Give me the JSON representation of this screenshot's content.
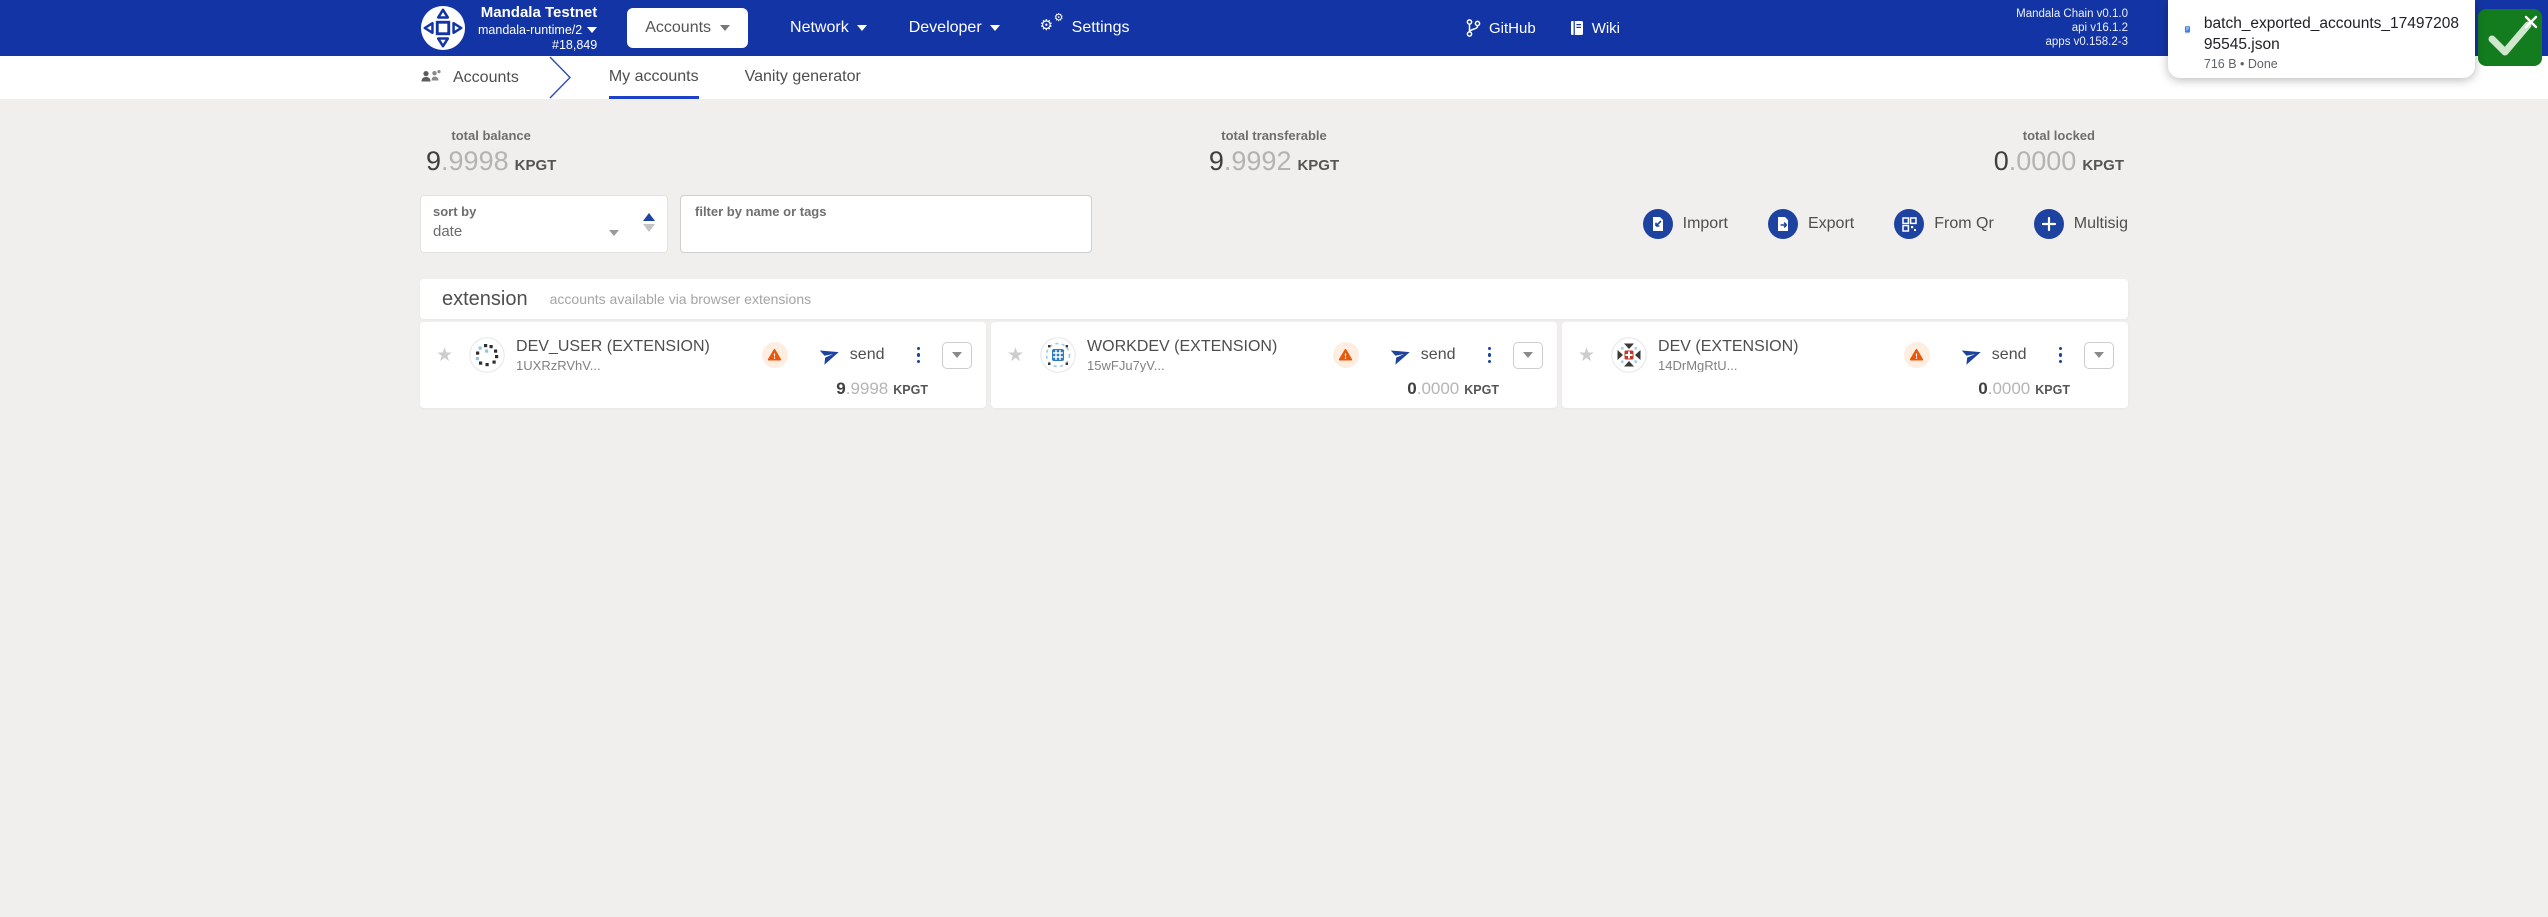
{
  "header": {
    "chain": {
      "name": "Mandala Testnet",
      "runtime": "mandala-runtime/2",
      "block": "#18,849"
    },
    "menu_accounts": "Accounts",
    "menu_network": "Network",
    "menu_developer": "Developer",
    "menu_settings": "Settings",
    "link_github": "GitHub",
    "link_wiki": "Wiki",
    "version": {
      "line1": "Mandala Chain v0.1.0",
      "line2": "api v16.1.2",
      "line3": "apps v0.158.2-3"
    }
  },
  "download_toast": {
    "filename_line1": "batch_exported_accounts_17497208",
    "filename_line2": "95545.json",
    "meta": "716 B • Done"
  },
  "subnav": {
    "breadcrumb": "Accounts",
    "tab_my_accounts": "My accounts",
    "tab_vanity": "Vanity generator"
  },
  "summary": {
    "columns": [
      {
        "label": "total balance",
        "int": "9",
        "frac": ".9998",
        "unit": "KPGT"
      },
      {
        "label": "total transferable",
        "int": "9",
        "frac": ".9992",
        "unit": "KPGT"
      },
      {
        "label": "total locked",
        "int": "0",
        "frac": ".0000",
        "unit": "KPGT"
      }
    ]
  },
  "filters": {
    "sort_label": "sort by",
    "sort_value": "date",
    "filter_label": "filter by name or tags",
    "actions": [
      {
        "label": "Import",
        "icon": "import-file-icon"
      },
      {
        "label": "Export",
        "icon": "export-file-icon"
      },
      {
        "label": "From Qr",
        "icon": "qr-code-icon"
      },
      {
        "label": "Multisig",
        "icon": "plus-icon"
      }
    ]
  },
  "section": {
    "title": "extension",
    "subtitle": "accounts available via browser extensions"
  },
  "accounts": [
    {
      "name": "DEV_USER (EXTENSION)",
      "address": "1UXRzRVhV...",
      "send_label": "send",
      "balance_int": "9",
      "balance_frac": ".9998",
      "unit": "KPGT"
    },
    {
      "name": "WORKDEV (EXTENSION)",
      "address": "15wFJu7yV...",
      "send_label": "send",
      "balance_int": "0",
      "balance_frac": ".0000",
      "unit": "KPGT"
    },
    {
      "name": "DEV (EXTENSION)",
      "address": "14DrMgRtU...",
      "send_label": "send",
      "balance_int": "0",
      "balance_frac": ".0000",
      "unit": "KPGT"
    }
  ],
  "colors": {
    "header_blue": "#1334a4",
    "accent_blue": "#1d429f",
    "tab_underline": "#1d42c8",
    "warning_orange": "#e8590c",
    "toast_green": "#137c1f",
    "page_bg": "#f0efed"
  }
}
